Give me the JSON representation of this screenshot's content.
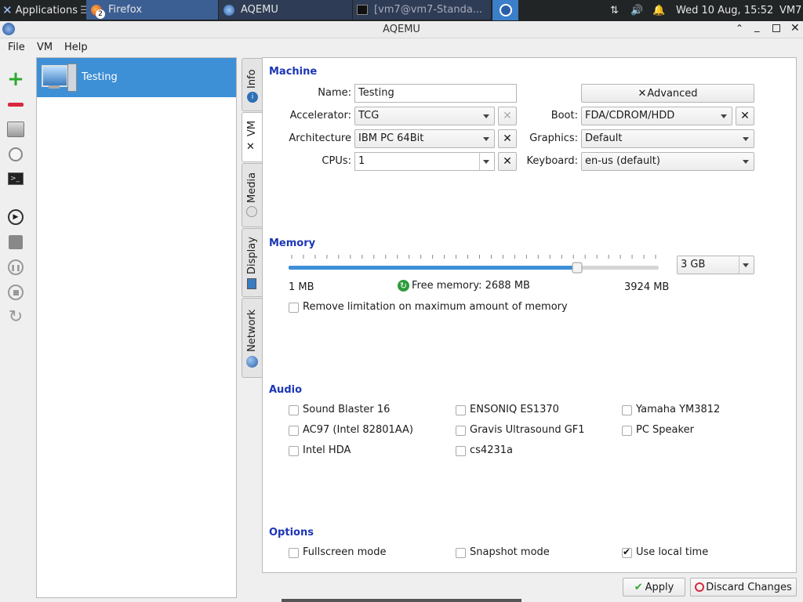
{
  "taskbar": {
    "applications": "Applications",
    "windows": [
      {
        "title": "Firefox",
        "badge": "2"
      },
      {
        "title": "AQEMU"
      },
      {
        "title": "[vm7@vm7-Standa..."
      },
      {
        "title": ""
      }
    ],
    "clock": "Wed 10 Aug, 15:52",
    "user": "VM7"
  },
  "window": {
    "title": "AQEMU"
  },
  "menu": [
    "File",
    "VM",
    "Help"
  ],
  "toolbar_icons": [
    "add-vm-icon",
    "remove-vm-icon",
    "hard-disk-icon",
    "clock-icon",
    "terminal-icon",
    "play-icon",
    "save-icon",
    "pause-icon",
    "stop-icon",
    "reset-icon"
  ],
  "vm_list": [
    {
      "name": "Testing",
      "selected": true
    }
  ],
  "tabs": [
    "Info",
    "VM",
    "Media",
    "Display",
    "Network"
  ],
  "selected_tab": "VM",
  "machine": {
    "section": "Machine",
    "name_label": "Name:",
    "name_value": "Testing",
    "advanced": "Advanced",
    "accelerator_label": "Accelerator:",
    "accelerator": "TCG",
    "architecture_label": "Architecture",
    "architecture": "IBM PC 64Bit",
    "cpus_label": "CPUs:",
    "cpus": "1",
    "boot_label": "Boot:",
    "boot": "FDA/CDROM/HDD",
    "graphics_label": "Graphics:",
    "graphics": "Default",
    "keyboard_label": "Keyboard:",
    "keyboard": "en-us (default)"
  },
  "memory": {
    "section": "Memory",
    "slider_fraction": 0.78,
    "value": "3 GB",
    "min": "1 MB",
    "free": "Free memory: 2688 MB",
    "max": "3924 MB",
    "remove_limit": "Remove limitation on maximum amount of memory",
    "remove_limit_checked": false
  },
  "audio": {
    "section": "Audio",
    "items": [
      {
        "label": "Sound Blaster 16",
        "checked": false
      },
      {
        "label": "ENSONIQ ES1370",
        "checked": false
      },
      {
        "label": "Yamaha YM3812",
        "checked": false
      },
      {
        "label": "AC97 (Intel 82801AA)",
        "checked": false
      },
      {
        "label": "Gravis Ultrasound GF1",
        "checked": false
      },
      {
        "label": "PC Speaker",
        "checked": false
      },
      {
        "label": "Intel HDA",
        "checked": false
      },
      {
        "label": "cs4231a",
        "checked": false
      }
    ]
  },
  "options": {
    "section": "Options",
    "items": [
      {
        "label": "Fullscreen mode",
        "checked": false
      },
      {
        "label": "Snapshot mode",
        "checked": false
      },
      {
        "label": "Use local time",
        "checked": true
      }
    ]
  },
  "buttons": {
    "apply": "Apply",
    "discard": "Discard Changes"
  },
  "colors": {
    "accent": "#3d8fd6",
    "section": "#1c36b6",
    "taskbar": "#222526"
  }
}
